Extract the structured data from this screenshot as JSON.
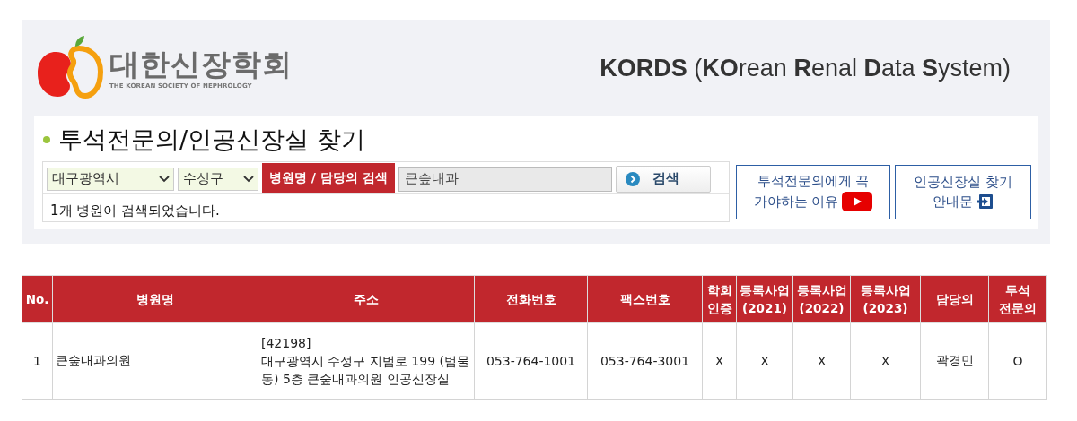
{
  "header": {
    "logo_korean": "대한신장학회",
    "logo_english": "THE KOREAN SOCIETY OF NEPHROLOGY",
    "system_title": "**KORDS** (**KO**rean **R**enal **D**ata **S**ystem)"
  },
  "search": {
    "title": "투석전문의/인공신장실 찾기",
    "region_select": "대구광역시",
    "district_select": "수성구",
    "search_label": "병원명 / 담당의 검색",
    "query": "큰숲내과",
    "search_button": "검색",
    "result_message": "1개 병원이 검색되었습니다."
  },
  "links": [
    {
      "kind": "video",
      "lines": [
        "투석전문의에게 꼭",
        "가야하는 이유"
      ]
    },
    {
      "kind": "guide",
      "lines": [
        "인공신장실 찾기",
        "안내문"
      ]
    }
  ],
  "table": {
    "columns": [
      "No.",
      "병원명",
      "주소",
      "전화번호",
      "팩스번호",
      "학회 인증",
      "등록사업 (2021)",
      "등록사업 (2022)",
      "등록사업 (2023)",
      "담당의",
      "투석 전문의"
    ],
    "rows": [
      {
        "no": "1",
        "name": "큰숲내과의원",
        "postcode": "[42198]",
        "address": "대구광역시 수성구 지범로 199 (범물동) 5층 큰숲내과의원 인공신장실",
        "phone": "053-764-1001",
        "fax": "053-764-3001",
        "certified": "X",
        "reg_2021": "X",
        "reg_2022": "X",
        "reg_2023": "X",
        "doctor": "곽경민",
        "specialist": "O"
      }
    ]
  }
}
